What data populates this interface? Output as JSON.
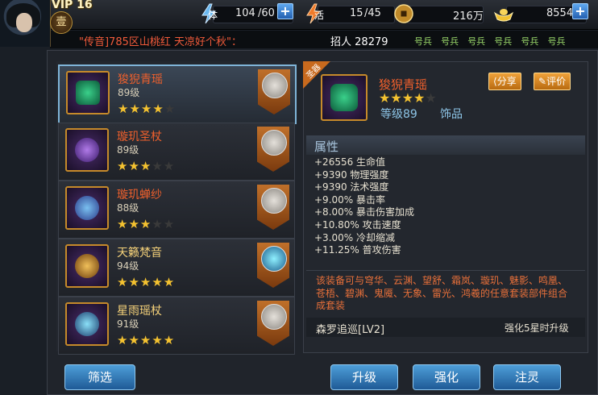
{
  "header": {
    "vip": "VIP 16",
    "rank": "壹",
    "stamina": {
      "label": "体",
      "value": "104",
      "max": "/60"
    },
    "energy": {
      "label": "活",
      "value": "15",
      "max": "/45"
    },
    "coins": "216万",
    "gold": "8554"
  },
  "ticker": {
    "message": "\"传音]785区山桃红 天凉好个秋\"：",
    "recruit_label": "招人",
    "recruit_count": "28279",
    "chips": [
      "号兵",
      "号兵",
      "号兵",
      "号兵",
      "号兵",
      "号兵"
    ]
  },
  "equipment_list": [
    {
      "name": "狻猊青瑶",
      "level": "89级",
      "stars": 4,
      "selected": true,
      "color": "#3ad08a"
    },
    {
      "name": "璇玑圣杖",
      "level": "89级",
      "stars": 3,
      "selected": false,
      "color": "#7a5ad8"
    },
    {
      "name": "璇玑蝉纱",
      "level": "88级",
      "stars": 3,
      "selected": false,
      "color": "#5aa0e8"
    },
    {
      "name": "天籁梵音",
      "level": "94级",
      "stars": 5,
      "selected": false,
      "color": "#d89a3a"
    },
    {
      "name": "星雨瑶杖",
      "level": "91级",
      "stars": 5,
      "selected": false,
      "color": "#5ac8e8"
    }
  ],
  "detail": {
    "tag": "圣器",
    "name": "狻猊青瑶",
    "stars": 4,
    "level": "等级89",
    "type": "饰品",
    "share_label": "分享",
    "review_label": "评价",
    "attr_title": "属性",
    "attributes": [
      "+26556 生命值",
      "+9390 物理强度",
      "+9390 法术强度",
      "+9.00% 暴击率",
      "+8.00% 暴击伤害加成",
      "+10.80% 攻击速度",
      "+3.00% 冷却缩减",
      "+11.25% 普攻伤害"
    ],
    "set_desc": "该装备可与穹华、云渊、望舒、霜岚、璇玑、魅影、鸣凰、苍梧、碧渊、鬼魇、无象、雷光、鸿羲的任意套装部件组合成套装",
    "set_name": "森罗追巡[LV2]",
    "set_note": "强化5星时升级"
  },
  "buttons": {
    "filter": "筛选",
    "upgrade": "升级",
    "enhance": "强化",
    "infuse": "注灵"
  }
}
